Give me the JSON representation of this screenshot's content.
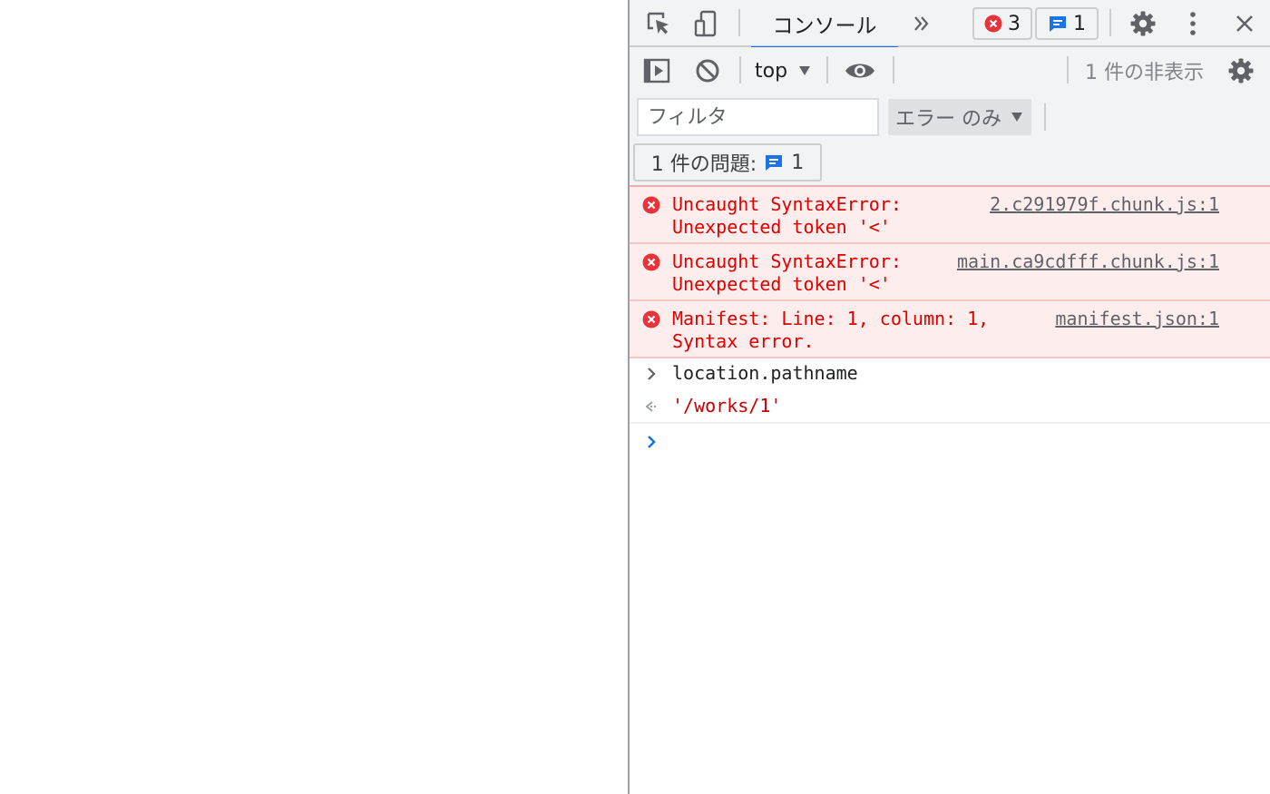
{
  "devtools": {
    "tabbar": {
      "inspect_icon": "inspect-element-icon",
      "device_icon": "device-toolbar-icon",
      "active_tab": "コンソール",
      "more_tabs_icon": "chevrons-right-icon",
      "error_count": "3",
      "issue_count": "1",
      "settings_icon": "gear-icon",
      "menu_icon": "kebab-menu-icon",
      "close_icon": "close-icon"
    },
    "toolbar": {
      "sidebar_icon": "sidebar-toggle-icon",
      "clear_icon": "clear-console-icon",
      "context": "top",
      "live_expression_icon": "eye-icon",
      "hidden_count": "1 件の非表示",
      "settings_icon": "gear-icon"
    },
    "filter": {
      "placeholder": "フィルタ",
      "value": "",
      "levels": "エラー のみ"
    },
    "issues": {
      "label": "1 件の問題:",
      "count": "1"
    },
    "messages": [
      {
        "type": "error",
        "text": "Uncaught SyntaxError:\nUnexpected token '<'",
        "source": "2.c291979f.chunk.js:1"
      },
      {
        "type": "error",
        "text": "Uncaught SyntaxError:\nUnexpected token '<'",
        "source": "main.ca9cdfff.chunk.js:1"
      },
      {
        "type": "error",
        "text": "Manifest: Line: 1, column: 1,\nSyntax error.",
        "source": "manifest.json:1"
      }
    ],
    "input_echo": "location.pathname",
    "result": "'/works/1'",
    "colors": {
      "error_text": "#e00000",
      "error_bg": "#fdeded",
      "accent": "#1a73e8",
      "toolbar_bg": "#f1f3f4"
    }
  }
}
